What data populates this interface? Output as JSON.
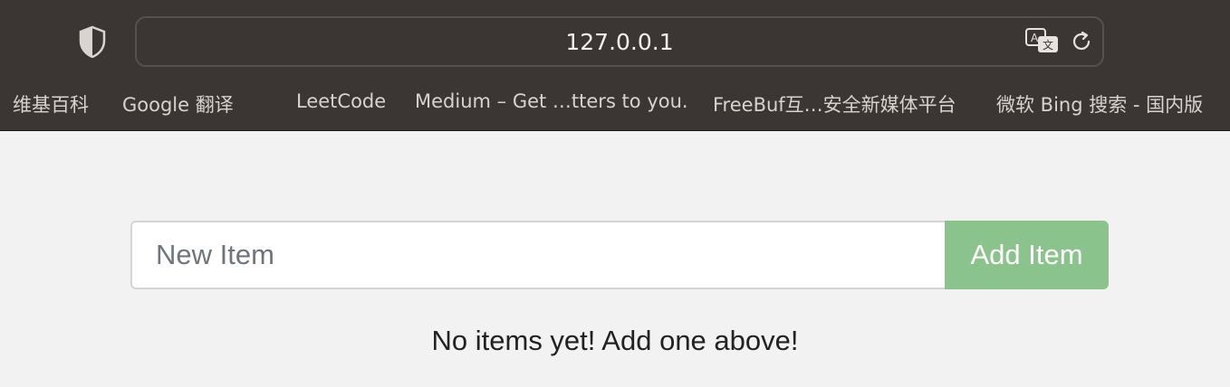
{
  "browser": {
    "url": "127.0.0.1",
    "icons": [
      "shield-icon",
      "translate-icon",
      "reload-icon"
    ],
    "bookmarks": [
      "维基百科",
      "Google 翻译",
      "LeetCode",
      "Medium – Get …tters to you.",
      "FreeBuf互…安全新媒体平台",
      "微软 Bing 搜索 - 国内版"
    ]
  },
  "form": {
    "placeholder": "New Item",
    "value": "",
    "add_label": "Add Item"
  },
  "list": {
    "empty_message": "No items yet! Add one above!"
  },
  "colors": {
    "chrome_bg": "#3b3633",
    "page_bg": "#f2f2f2",
    "button_bg": "#8bc38c"
  }
}
